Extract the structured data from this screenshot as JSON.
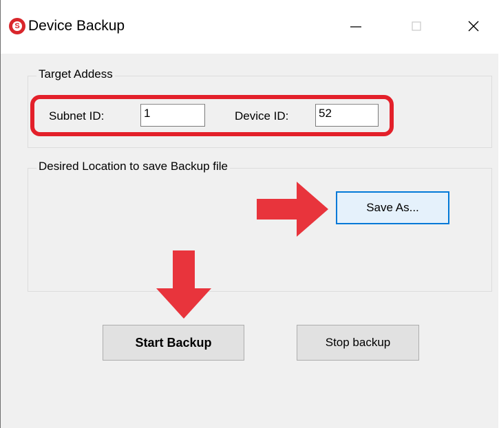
{
  "window": {
    "title": "Device Backup",
    "minimize_glyph": "—",
    "maximize_glyph": "☐",
    "close_glyph": "✕",
    "app_icon_letter": "S"
  },
  "target_group": {
    "legend": "Target Addess",
    "subnet_label": "Subnet ID:",
    "subnet_value": "1",
    "device_label": "Device ID:",
    "device_value": "52"
  },
  "location_group": {
    "legend": "Desired Location to save Backup file",
    "save_as_label": "Save As..."
  },
  "actions": {
    "start_label": "Start Backup",
    "stop_label": "Stop backup"
  },
  "colors": {
    "highlight": "#e3202a",
    "arrow": "#e8343c",
    "accent": "#0078d7"
  }
}
